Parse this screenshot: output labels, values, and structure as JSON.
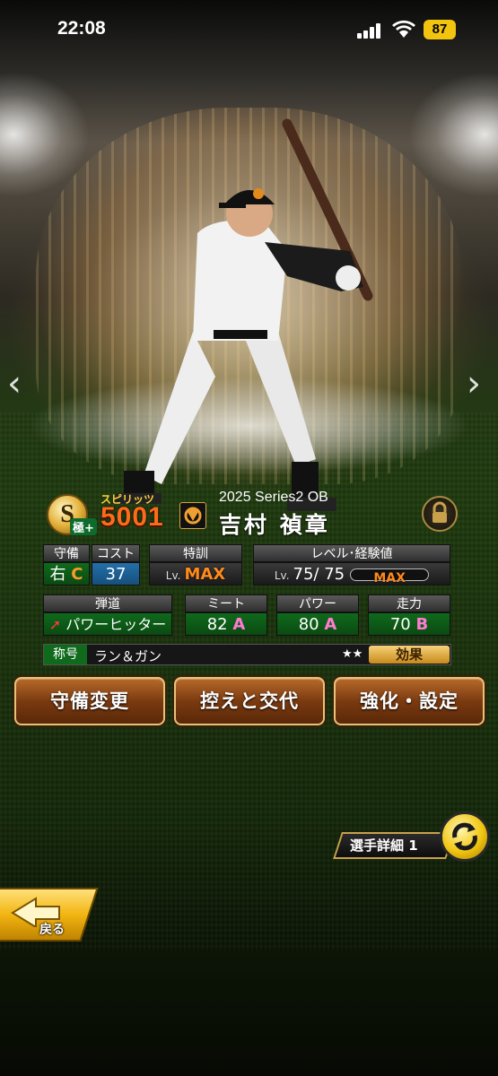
{
  "status_bar": {
    "time": "22:08",
    "battery": "87"
  },
  "player": {
    "spirits_label": "スピリッツ",
    "spirits": "5001",
    "rank_letter": "S",
    "kiwami": "極+",
    "series": "2025 Series2 OB",
    "name": "吉村 禎章"
  },
  "stats": {
    "defense": {
      "head": "守備",
      "position": "右",
      "grade": "C"
    },
    "cost": {
      "head": "コスト",
      "value": "37"
    },
    "training": {
      "head": "特訓",
      "lv": "Lv.",
      "value": "MAX"
    },
    "level": {
      "head": "レベル･経験値",
      "lv": "Lv.",
      "value": "75/ 75",
      "exp": "MAX"
    },
    "trajectory": {
      "head": "弾道",
      "value": "パワーヒッター"
    },
    "meet": {
      "head": "ミート",
      "value": "82",
      "grade": "A"
    },
    "power": {
      "head": "パワー",
      "value": "80",
      "grade": "A"
    },
    "speed": {
      "head": "走力",
      "value": "70",
      "grade": "B"
    }
  },
  "title_row": {
    "label": "称号",
    "value": "ラン＆ガン",
    "stars": "★★",
    "effect": "効果"
  },
  "buttons": {
    "defense_change": "守備変更",
    "bench_swap": "控えと交代",
    "enhance": "強化・設定"
  },
  "detail": {
    "label": "選手詳細 1"
  },
  "back": {
    "label": "戻る"
  },
  "nav": {
    "left": "‹",
    "right": "›"
  },
  "colors": {
    "spirits": "#ff6a1a",
    "max": "#ff8a1c",
    "grade_a": "#ff7ad0",
    "grade_c": "#ff9a2a",
    "accent_green": "#0f6a1c"
  }
}
